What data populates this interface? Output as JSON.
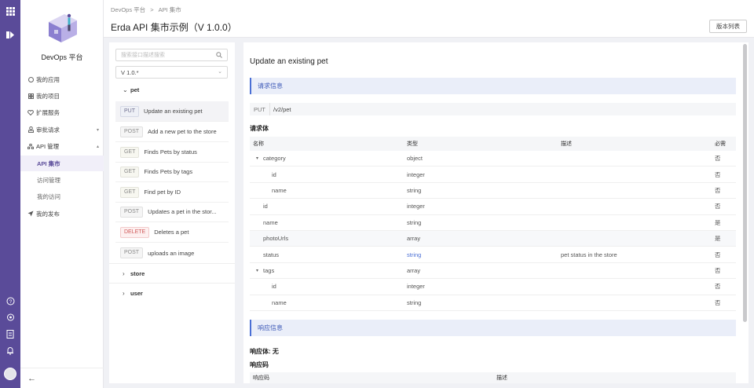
{
  "rail": {
    "icons": [
      "grid-icon",
      "brand-icon",
      "help-icon",
      "location-icon",
      "doc-icon",
      "bell-icon",
      "avatar"
    ]
  },
  "sidebar": {
    "platform_title": "DevOps 平台",
    "items": [
      {
        "label": "我的应用",
        "icon": "app-icon"
      },
      {
        "label": "我的项目",
        "icon": "project-icon"
      },
      {
        "label": "扩展服务",
        "icon": "heart-icon"
      },
      {
        "label": "审批请求",
        "icon": "approval-icon"
      },
      {
        "label": "API 管理",
        "icon": "api-icon"
      }
    ],
    "subitems": [
      {
        "label": "API 集市"
      },
      {
        "label": "访问管理"
      },
      {
        "label": "我的访问"
      }
    ],
    "last_item": {
      "label": "我的发布",
      "icon": "send-icon"
    },
    "collapse_glyph": "←"
  },
  "header": {
    "breadcrumb": [
      "DevOps 平台",
      "API 集市"
    ],
    "breadcrumb_sep": ">",
    "title": "Erda API 集市示例（V 1.0.0）",
    "version_button": "版本列表"
  },
  "apilist": {
    "search_placeholder": "搜索接口描述搜索",
    "version": "V 1.0.*",
    "groups": {
      "pet": "pet",
      "store": "store",
      "user": "user"
    },
    "apis": [
      {
        "method": "PUT",
        "desc": "Update an existing pet",
        "selected": true
      },
      {
        "method": "POST",
        "desc": "Add a new pet to the store"
      },
      {
        "method": "GET",
        "desc": "Finds Pets by status"
      },
      {
        "method": "GET",
        "desc": "Finds Pets by tags"
      },
      {
        "method": "GET",
        "desc": "Find pet by ID"
      },
      {
        "method": "POST",
        "desc": "Updates a pet in the stor..."
      },
      {
        "method": "DELETE",
        "desc": "Deletes a pet"
      },
      {
        "method": "POST",
        "desc": "uploads an image"
      }
    ]
  },
  "detail": {
    "title": "Update an existing pet",
    "request_section": "请求信息",
    "method": "PUT",
    "path": "/v2/pet",
    "body_label": "请求体",
    "columns": [
      "名称",
      "类型",
      "描述",
      "必需"
    ],
    "rows": [
      {
        "name": "category",
        "type": "object",
        "desc": "",
        "required": "否",
        "toggle": "▾",
        "indent": 0
      },
      {
        "name": "id",
        "type": "integer",
        "desc": "",
        "required": "否",
        "indent": 1
      },
      {
        "name": "name",
        "type": "string",
        "desc": "",
        "required": "否",
        "indent": 1
      },
      {
        "name": "id",
        "type": "integer",
        "desc": "",
        "required": "否",
        "indent": 0
      },
      {
        "name": "name",
        "type": "string",
        "desc": "",
        "required": "是",
        "indent": 0
      },
      {
        "name": "photoUrls",
        "type": "array",
        "desc": "",
        "required": "是",
        "indent": 0
      },
      {
        "name": "status",
        "type": "string",
        "desc": "pet status in the store",
        "required": "否",
        "indent": 0,
        "link": true
      },
      {
        "name": "tags",
        "type": "array",
        "desc": "",
        "required": "否",
        "toggle": "▾",
        "indent": 0
      },
      {
        "name": "id",
        "type": "integer",
        "desc": "",
        "required": "否",
        "indent": 1
      },
      {
        "name": "name",
        "type": "string",
        "desc": "",
        "required": "否",
        "indent": 1
      }
    ],
    "response_section": "响应信息",
    "response_body": "响应体: 无",
    "response_code_label": "响应码",
    "response_columns": [
      "响应码",
      "描述"
    ]
  }
}
